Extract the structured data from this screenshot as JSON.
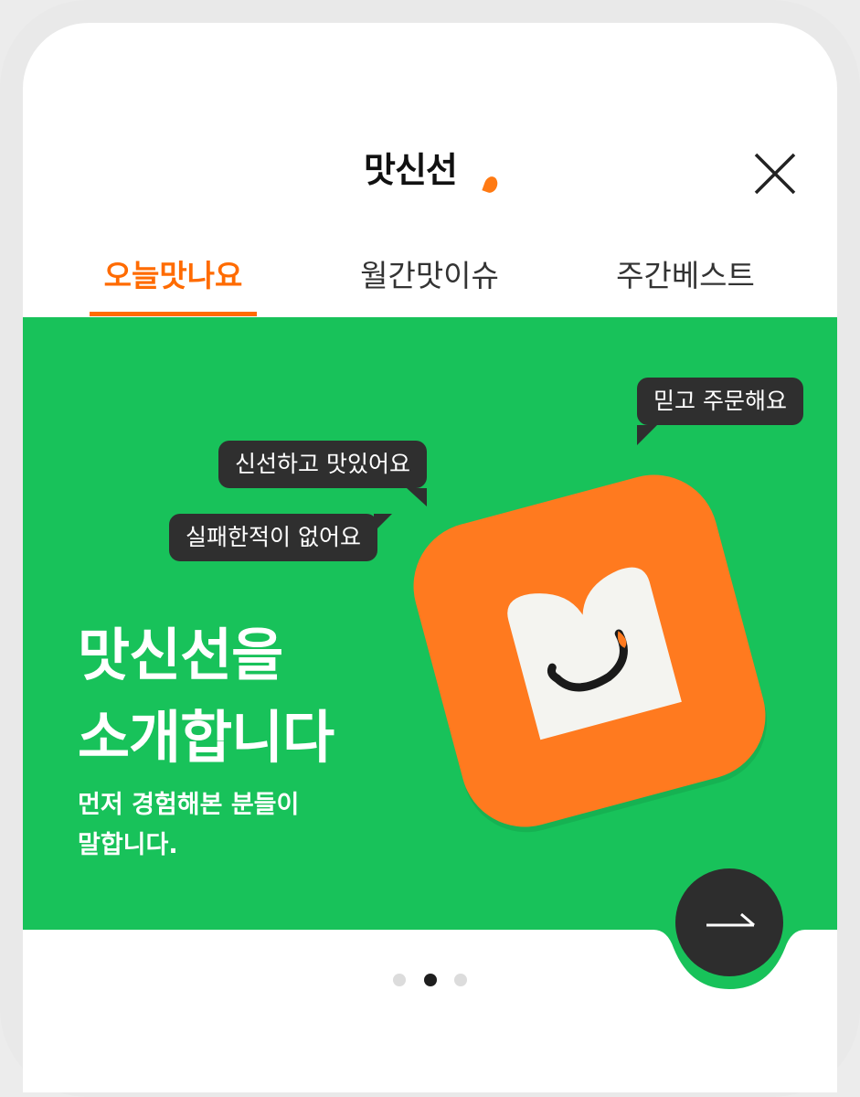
{
  "header": {
    "logo_text": "맛신선",
    "close_icon": "close-icon"
  },
  "tabs": [
    {
      "label": "오늘맛나요",
      "active": true
    },
    {
      "label": "월간맛이슈",
      "active": false
    },
    {
      "label": "주간베스트",
      "active": false
    }
  ],
  "banner": {
    "bubbles": [
      "믿고 주문해요",
      "신선하고 맛있어요",
      "실패한적이 없어요"
    ],
    "title_line1": "맛신선을",
    "title_line2": "소개합니다",
    "subtitle_line1": "먼저 경험해본 분들이",
    "subtitle_line2": "말합니다.",
    "next_icon": "arrow-right-icon"
  },
  "carousel": {
    "total_dots": 3,
    "active_index": 1
  },
  "colors": {
    "accent": "#ff6b00",
    "banner_bg": "#18c25a",
    "icon_orange": "#ff7a1f",
    "bubble_bg": "#2f2f2f"
  }
}
